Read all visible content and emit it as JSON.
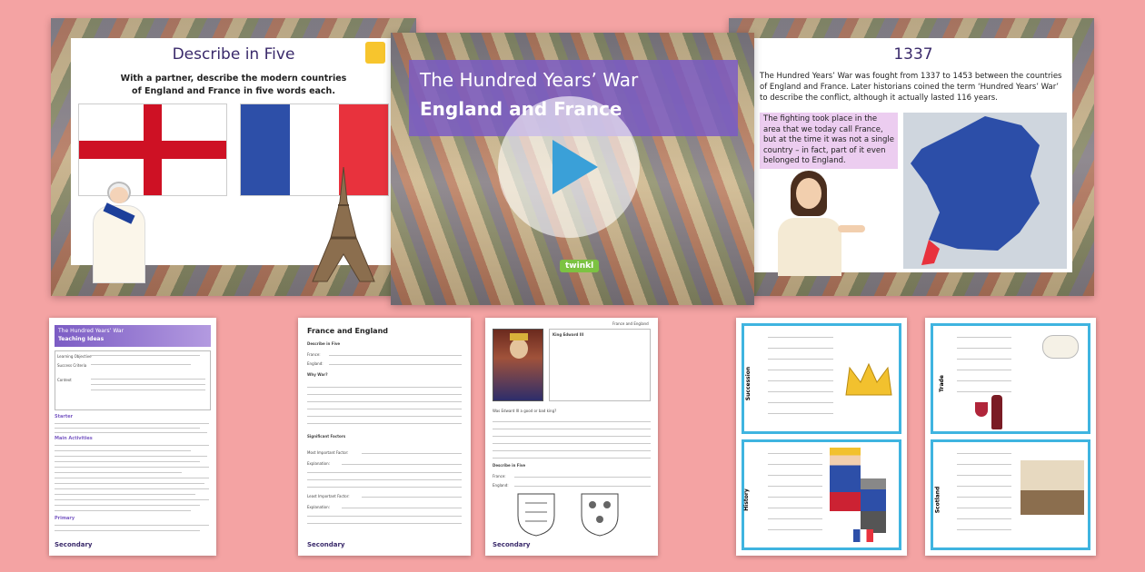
{
  "slide_left": {
    "title": "Describe in Five",
    "instruction": "With a partner, describe the modern countries of England and France in five words each."
  },
  "slide_center": {
    "title_line1": "The Hundred Years’ War",
    "title_line2": "England and France",
    "logo": "twinkl"
  },
  "slide_right": {
    "title": "1337",
    "body": "The Hundred Years’ War was fought from 1337 to 1453 between the countries of England and France. Later historians coined the term ‘Hundred Years’ War’ to describe the conflict, although it actually lasted 116 years.",
    "callout": "The fighting took place in the area that we today call France, but at the time it was not a single country – in fact, part of it even belonged to England."
  },
  "doc1": {
    "banner_title": "The Hundred Years’ War",
    "banner_sub": "Teaching Ideas",
    "rows": [
      "Learning Objective",
      "Success Criteria",
      "Context"
    ],
    "sections": [
      "Starter",
      "Main Activities",
      "Primary"
    ],
    "footer": "Secondary"
  },
  "doc2": {
    "title": "France and England",
    "headings": [
      "Describe in Five",
      "Why War?",
      "Significant Factors"
    ],
    "labels": [
      "France:",
      "England:",
      "Most Important Factor:",
      "Explanation:",
      "Least Important Factor:",
      "Explanation:"
    ],
    "footer": "Secondary"
  },
  "doc3": {
    "header": "France and England",
    "portrait_caption": "King Edward III",
    "question": "Was Edward III a good or bad king?",
    "heading": "Describe in Five",
    "labels": [
      "France:",
      "England:"
    ],
    "footer": "Secondary"
  },
  "doc4": {
    "side_labels": [
      "Succession",
      "History"
    ]
  },
  "doc5": {
    "side_labels": [
      "Trade",
      "Scotland"
    ]
  },
  "colors": {
    "background": "#f4a3a3",
    "title_purple": "#3a2a6b",
    "card_border": "#3fb4e0",
    "banner_purple": "#7b5cc4"
  }
}
